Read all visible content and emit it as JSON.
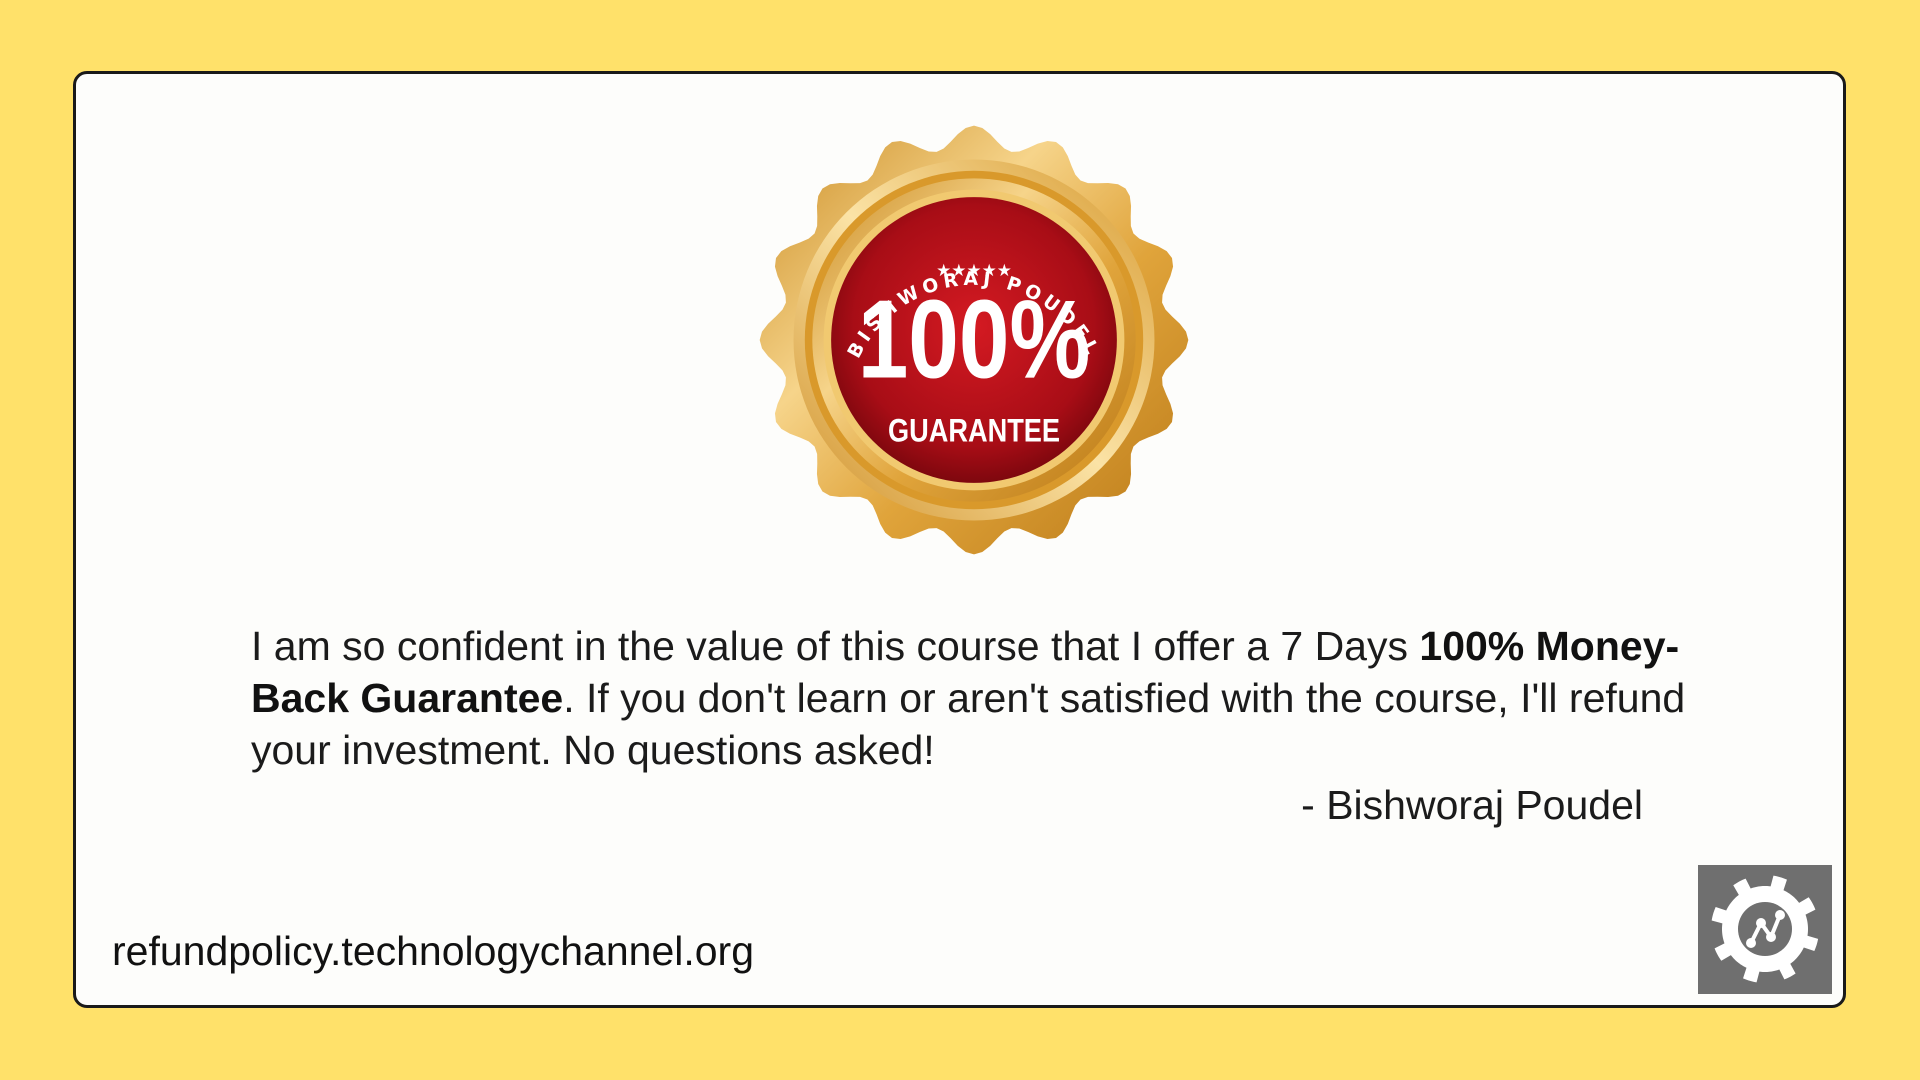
{
  "badge": {
    "arc_text": "BISHWORAJ POUDEL",
    "stars": "★★★★★",
    "percent": "100%",
    "label": "GUARANTEE"
  },
  "message": {
    "part1": "I am so confident in the value of this course that I offer a 7 Days ",
    "bold": "100% Money-Back Guarantee",
    "part2": ". If you don't learn or aren't satisfied with the course, I'll refund your investment. No questions asked!"
  },
  "signature": "- Bishworaj Poudel",
  "site_url": "refundpolicy.technologychannel.org",
  "icons": {
    "badge": "gold-seal-icon",
    "logo": "gear-network-icon"
  },
  "colors": {
    "background": "#ffe16a",
    "card": "#fdfdfb",
    "gold": "#e2a83a",
    "red": "#b3111a",
    "logo_bg": "#6f6f6f"
  }
}
